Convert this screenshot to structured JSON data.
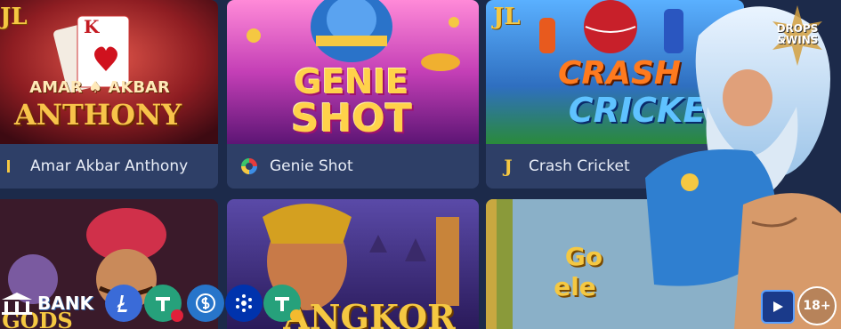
{
  "cards": [
    {
      "title": "Amar Akbar Anthony",
      "art_title_line1": "AMAR",
      "art_title_amp": "AKBAR",
      "art_title_line2": "ANTHONY",
      "card_rank": "K",
      "provider_tag": "JL"
    },
    {
      "title": "Genie Shot",
      "art_title_line1": "GENIE",
      "art_title_line2": "SHOT"
    },
    {
      "title": "Crash Cricket",
      "art_title_line1": "CRASH",
      "art_title_line2": "CRICKE",
      "provider_tag": "JL",
      "label_icon": "J"
    }
  ],
  "row2": [
    {
      "art_title": "GODS"
    },
    {
      "art_title": "ANGKOR"
    },
    {
      "art_title_line1": "Go",
      "art_title_line2": "ele"
    }
  ],
  "promo": {
    "logo_line1": "DROPS",
    "logo_line2": "&WINS"
  },
  "payments": {
    "bank": "BANK",
    "coins": [
      "litecoin",
      "tether-tron",
      "usd-coin",
      "cardano",
      "tether-bnb"
    ]
  },
  "age_badge": "18+",
  "colors": {
    "background": "#1c2a4a",
    "card_label": "#2e3f67",
    "gold": "#f5c842"
  }
}
